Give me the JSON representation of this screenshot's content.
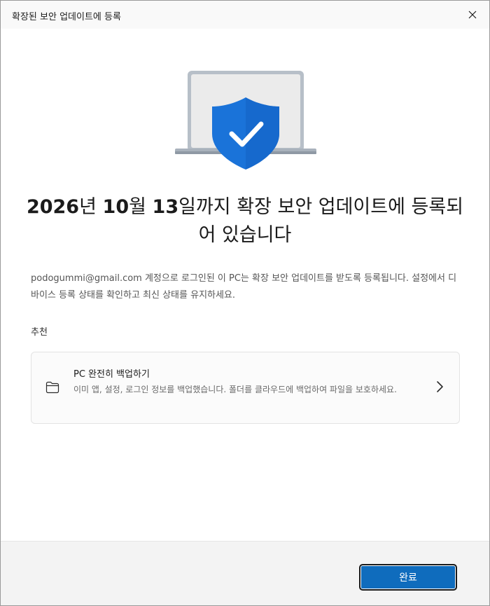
{
  "window": {
    "title": "확장된 보안 업데이트에 등록"
  },
  "headline": {
    "date_bold_1": "2026",
    "unit_1": "년 ",
    "date_bold_2": "10",
    "unit_2": "월 ",
    "date_bold_3": "13",
    "rest": "일까지 확장 보안 업데이트에 등록되어 있습니다"
  },
  "description": "podogummi@gmail.com 계정으로 로그인된 이 PC는 확장 보안 업데이트를 받도록 등록됩니다. 설정에서 디바이스 등록 상태를 확인하고 최신 상태를 유지하세요.",
  "recommendation": {
    "section_label": "추천",
    "card": {
      "icon": "folder-icon",
      "title": "PC 완전히 백업하기",
      "description": "이미 앱, 설정, 로그인 정보를 백업했습니다. 폴더를 클라우드에 백업하여 파일을 보호하세요."
    }
  },
  "footer": {
    "done_label": "완료"
  },
  "colors": {
    "accent": "#0f6cbd",
    "shield": "#1a73d9"
  }
}
